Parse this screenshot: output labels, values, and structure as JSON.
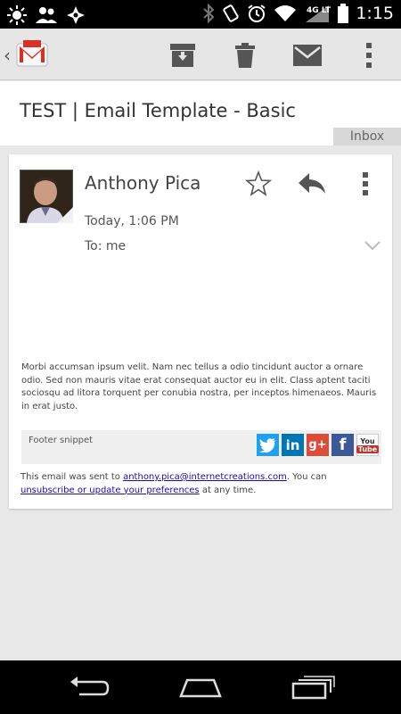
{
  "status_bar": {
    "time": "1:15",
    "network": "4G LTE",
    "icons": [
      "brightness-icon",
      "people-icon",
      "photo-icon",
      "bluetooth-icon",
      "vibrate-icon",
      "alarm-icon",
      "wifi-icon",
      "signal-icon",
      "battery-icon"
    ]
  },
  "toolbar": {
    "icons": [
      "gmail-logo",
      "archive-icon",
      "delete-icon",
      "mark-unread-icon",
      "overflow-icon"
    ]
  },
  "email": {
    "subject": "TEST | Email Template - Basic",
    "label": "Inbox",
    "sender": "Anthony Pica",
    "date": "Today, 1:06 PM",
    "recipient": "To: me",
    "body": "Morbi accumsan ipsum velit. Nam nec tellus a odio tincidunt auctor a ornare odio. Sed non mauris vitae erat consequat auctor eu in elit. Class aptent taciti sociosqu ad litora torquent per conubia nostra, per inceptos himenaeos. Mauris in erat justo.",
    "footer_snippet": "Footer snippet",
    "social": {
      "twitter": "t",
      "linkedin": "in",
      "googleplus": "g+",
      "facebook": "f",
      "youtube": "You Tube"
    },
    "legal": {
      "prefix": "This email was sent to ",
      "email_link": "anthony.pica@internetcreations.com",
      "middle": ". You can ",
      "unsubscribe_link": "unsubscribe or update your preferences",
      "suffix": " at any time."
    }
  },
  "colors": {
    "twitter": "#1da1f2",
    "linkedin": "#0077b5",
    "googleplus": "#dd4b39",
    "facebook": "#3b5998",
    "youtube": "#c4302b"
  }
}
